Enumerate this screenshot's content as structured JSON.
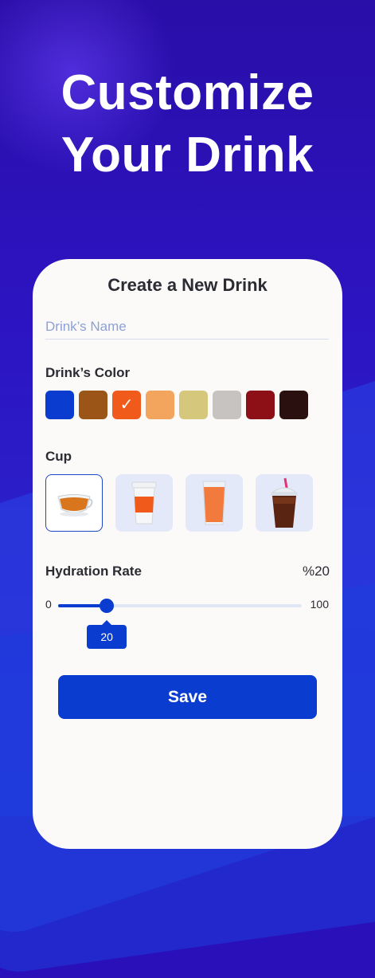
{
  "headline": {
    "line1": "Customize",
    "line2": "Your Drink"
  },
  "form": {
    "title": "Create a New Drink",
    "name_placeholder": "Drink’s Name",
    "name_value": "",
    "color_label": "Drink’s Color",
    "colors": [
      {
        "name": "blue",
        "hex": "#0a3ccf",
        "selected": false
      },
      {
        "name": "brown",
        "hex": "#9b5516",
        "selected": false
      },
      {
        "name": "orange",
        "hex": "#f05a1b",
        "selected": true
      },
      {
        "name": "light-orange",
        "hex": "#f3a55e",
        "selected": false
      },
      {
        "name": "khaki",
        "hex": "#d5c87c",
        "selected": false
      },
      {
        "name": "light-gray",
        "hex": "#c7c3c0",
        "selected": false
      },
      {
        "name": "dark-red",
        "hex": "#8c1016",
        "selected": false
      },
      {
        "name": "dark-brown",
        "hex": "#2b1010",
        "selected": false
      }
    ],
    "cup_label": "Cup",
    "cups": [
      {
        "name": "tea-cup",
        "selected": true
      },
      {
        "name": "coffee-cup",
        "selected": false
      },
      {
        "name": "juice-glass",
        "selected": false
      },
      {
        "name": "iced-drink-cup",
        "selected": false
      }
    ],
    "hydration_label": "Hydration Rate",
    "hydration_display": "%20",
    "slider": {
      "min": "0",
      "max": "100",
      "value": 20,
      "value_label": "20"
    },
    "save_label": "Save"
  }
}
